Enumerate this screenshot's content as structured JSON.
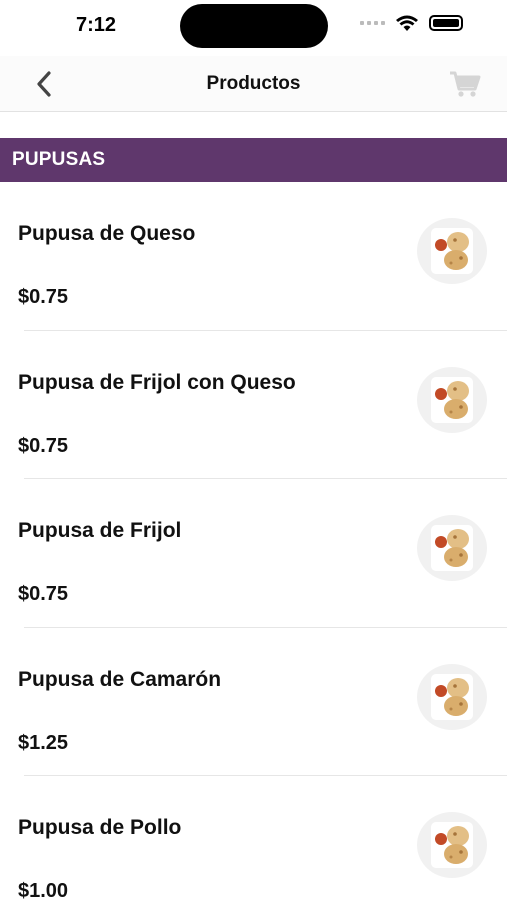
{
  "status_bar": {
    "time": "7:12",
    "icons": [
      "cellular-dots-icon",
      "wifi-icon",
      "battery-icon"
    ]
  },
  "nav": {
    "title": "Productos",
    "back_icon": "chevron-left-icon",
    "cart_icon": "cart-icon"
  },
  "category": {
    "label": "PUPUSAS",
    "color": "#5f376c"
  },
  "products": [
    {
      "name": "Pupusa de Queso",
      "price": "$0.75",
      "image_icon": "pupusa-thumbnail"
    },
    {
      "name": "Pupusa de Frijol con Queso",
      "price": "$0.75",
      "image_icon": "pupusa-thumbnail"
    },
    {
      "name": "Pupusa de Frijol",
      "price": "$0.75",
      "image_icon": "pupusa-thumbnail"
    },
    {
      "name": "Pupusa de Camarón",
      "price": "$1.25",
      "image_icon": "pupusa-thumbnail"
    },
    {
      "name": "Pupusa de Pollo",
      "price": "$1.00",
      "image_icon": "pupusa-thumbnail"
    }
  ]
}
